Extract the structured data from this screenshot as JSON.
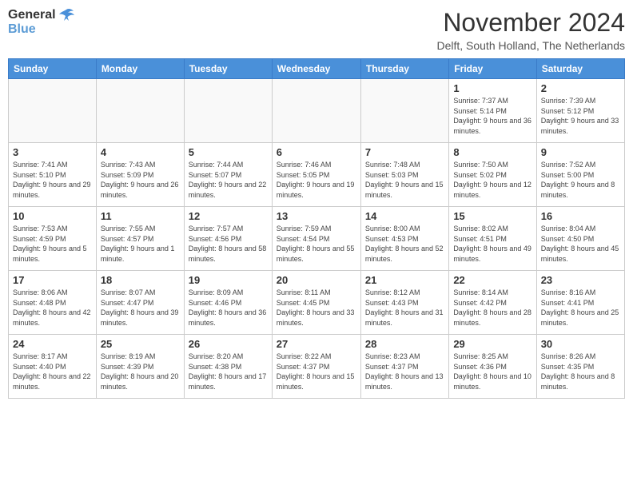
{
  "header": {
    "logo_general": "General",
    "logo_blue": "Blue",
    "month_year": "November 2024",
    "location": "Delft, South Holland, The Netherlands"
  },
  "weekdays": [
    "Sunday",
    "Monday",
    "Tuesday",
    "Wednesday",
    "Thursday",
    "Friday",
    "Saturday"
  ],
  "weeks": [
    [
      {
        "day": "",
        "info": ""
      },
      {
        "day": "",
        "info": ""
      },
      {
        "day": "",
        "info": ""
      },
      {
        "day": "",
        "info": ""
      },
      {
        "day": "",
        "info": ""
      },
      {
        "day": "1",
        "info": "Sunrise: 7:37 AM\nSunset: 5:14 PM\nDaylight: 9 hours and 36 minutes."
      },
      {
        "day": "2",
        "info": "Sunrise: 7:39 AM\nSunset: 5:12 PM\nDaylight: 9 hours and 33 minutes."
      }
    ],
    [
      {
        "day": "3",
        "info": "Sunrise: 7:41 AM\nSunset: 5:10 PM\nDaylight: 9 hours and 29 minutes."
      },
      {
        "day": "4",
        "info": "Sunrise: 7:43 AM\nSunset: 5:09 PM\nDaylight: 9 hours and 26 minutes."
      },
      {
        "day": "5",
        "info": "Sunrise: 7:44 AM\nSunset: 5:07 PM\nDaylight: 9 hours and 22 minutes."
      },
      {
        "day": "6",
        "info": "Sunrise: 7:46 AM\nSunset: 5:05 PM\nDaylight: 9 hours and 19 minutes."
      },
      {
        "day": "7",
        "info": "Sunrise: 7:48 AM\nSunset: 5:03 PM\nDaylight: 9 hours and 15 minutes."
      },
      {
        "day": "8",
        "info": "Sunrise: 7:50 AM\nSunset: 5:02 PM\nDaylight: 9 hours and 12 minutes."
      },
      {
        "day": "9",
        "info": "Sunrise: 7:52 AM\nSunset: 5:00 PM\nDaylight: 9 hours and 8 minutes."
      }
    ],
    [
      {
        "day": "10",
        "info": "Sunrise: 7:53 AM\nSunset: 4:59 PM\nDaylight: 9 hours and 5 minutes."
      },
      {
        "day": "11",
        "info": "Sunrise: 7:55 AM\nSunset: 4:57 PM\nDaylight: 9 hours and 1 minute."
      },
      {
        "day": "12",
        "info": "Sunrise: 7:57 AM\nSunset: 4:56 PM\nDaylight: 8 hours and 58 minutes."
      },
      {
        "day": "13",
        "info": "Sunrise: 7:59 AM\nSunset: 4:54 PM\nDaylight: 8 hours and 55 minutes."
      },
      {
        "day": "14",
        "info": "Sunrise: 8:00 AM\nSunset: 4:53 PM\nDaylight: 8 hours and 52 minutes."
      },
      {
        "day": "15",
        "info": "Sunrise: 8:02 AM\nSunset: 4:51 PM\nDaylight: 8 hours and 49 minutes."
      },
      {
        "day": "16",
        "info": "Sunrise: 8:04 AM\nSunset: 4:50 PM\nDaylight: 8 hours and 45 minutes."
      }
    ],
    [
      {
        "day": "17",
        "info": "Sunrise: 8:06 AM\nSunset: 4:48 PM\nDaylight: 8 hours and 42 minutes."
      },
      {
        "day": "18",
        "info": "Sunrise: 8:07 AM\nSunset: 4:47 PM\nDaylight: 8 hours and 39 minutes."
      },
      {
        "day": "19",
        "info": "Sunrise: 8:09 AM\nSunset: 4:46 PM\nDaylight: 8 hours and 36 minutes."
      },
      {
        "day": "20",
        "info": "Sunrise: 8:11 AM\nSunset: 4:45 PM\nDaylight: 8 hours and 33 minutes."
      },
      {
        "day": "21",
        "info": "Sunrise: 8:12 AM\nSunset: 4:43 PM\nDaylight: 8 hours and 31 minutes."
      },
      {
        "day": "22",
        "info": "Sunrise: 8:14 AM\nSunset: 4:42 PM\nDaylight: 8 hours and 28 minutes."
      },
      {
        "day": "23",
        "info": "Sunrise: 8:16 AM\nSunset: 4:41 PM\nDaylight: 8 hours and 25 minutes."
      }
    ],
    [
      {
        "day": "24",
        "info": "Sunrise: 8:17 AM\nSunset: 4:40 PM\nDaylight: 8 hours and 22 minutes."
      },
      {
        "day": "25",
        "info": "Sunrise: 8:19 AM\nSunset: 4:39 PM\nDaylight: 8 hours and 20 minutes."
      },
      {
        "day": "26",
        "info": "Sunrise: 8:20 AM\nSunset: 4:38 PM\nDaylight: 8 hours and 17 minutes."
      },
      {
        "day": "27",
        "info": "Sunrise: 8:22 AM\nSunset: 4:37 PM\nDaylight: 8 hours and 15 minutes."
      },
      {
        "day": "28",
        "info": "Sunrise: 8:23 AM\nSunset: 4:37 PM\nDaylight: 8 hours and 13 minutes."
      },
      {
        "day": "29",
        "info": "Sunrise: 8:25 AM\nSunset: 4:36 PM\nDaylight: 8 hours and 10 minutes."
      },
      {
        "day": "30",
        "info": "Sunrise: 8:26 AM\nSunset: 4:35 PM\nDaylight: 8 hours and 8 minutes."
      }
    ]
  ]
}
